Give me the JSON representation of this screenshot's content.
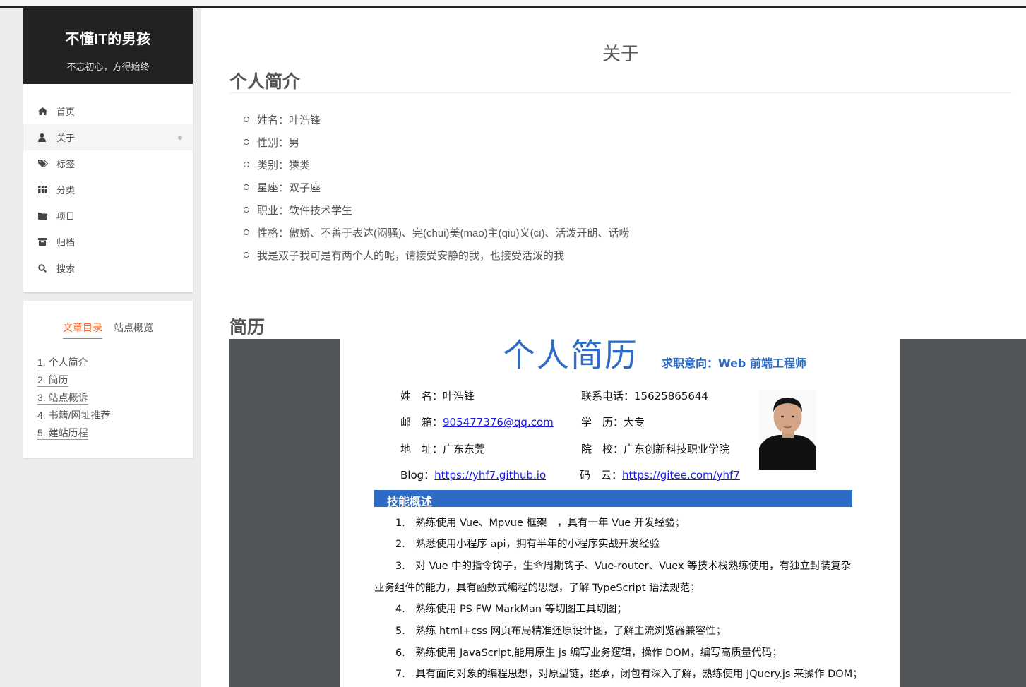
{
  "site": {
    "title": "不懂IT的男孩",
    "subtitle": "不忘初心，方得始终"
  },
  "menu": [
    {
      "icon": "home-icon",
      "label": "首页"
    },
    {
      "icon": "user-icon",
      "label": "关于",
      "active": true
    },
    {
      "icon": "tags-icon",
      "label": "标签"
    },
    {
      "icon": "grid-icon",
      "label": "分类"
    },
    {
      "icon": "folder-icon",
      "label": "项目"
    },
    {
      "icon": "archive-icon",
      "label": "归档"
    },
    {
      "icon": "search-icon",
      "label": "搜索"
    }
  ],
  "toc": {
    "tabs": [
      "文章目录",
      "站点概览"
    ],
    "items": [
      "1. 个人简介",
      "2. 简历",
      "3. 站点概诉",
      "4. 书籍/网址推荐",
      "5. 建站历程"
    ]
  },
  "post": {
    "title": "关于",
    "section1": "个人简介",
    "bio": [
      "姓名：叶浩锋",
      "性别：男",
      "类别：猿类",
      "星座：双子座",
      "职业：软件技术学生",
      "性格：傲娇、不善于表达(闷骚)、完(chui)美(mao)主(qiu)义(ci)、活泼开朗、话唠",
      "我是双子我可是有两个人的呢，请接受安静的我，也接受活泼的我"
    ],
    "section2": "简历"
  },
  "resume": {
    "title": "个人简历",
    "intent": "求职意向：Web 前端工程师",
    "name": "姓　名：叶浩锋",
    "phone": "联系电话：15625865644",
    "email_label": "邮　箱：",
    "email": "905477376@qq.com",
    "education": "学　历：大专",
    "address": "地　址：广东东莞",
    "school": "院　校：广东创新科技职业学院",
    "blog_label": "Blog：",
    "blog": "https://yhf7.github.io",
    "gitee_label": "码　云：",
    "gitee": "https://gitee.com/yhf7",
    "skills_header": "技能概述",
    "skills": [
      "1.　熟练使用 Vue、Mpvue 框架　，具有一年 Vue 开发经验；",
      "2.　熟悉使用小程序 api，拥有半年的小程序实战开发经验",
      "3.　对 Vue 中的指令钩子，生命周期钩子、Vue-router、Vuex 等技术栈熟练使用，有独立封装复杂",
      "业务组件的能力，具有函数式编程的思想，了解 TypeScript 语法规范；",
      "4.　熟练使用 PS FW MarkMan 等切图工具切图；",
      "5.　熟练 html+css 网页布局精准还原设计图，了解主流浏览器兼容性；",
      "6.　熟练使用 JavaScript,能用原生 js 编写业务逻辑，操作 DOM，编写高质量代码；",
      "7.　具有面向对象的编程思想，对原型链，继承，闭包有深入了解，熟练使用 JQuery.js 来操作 DOM；"
    ]
  }
}
